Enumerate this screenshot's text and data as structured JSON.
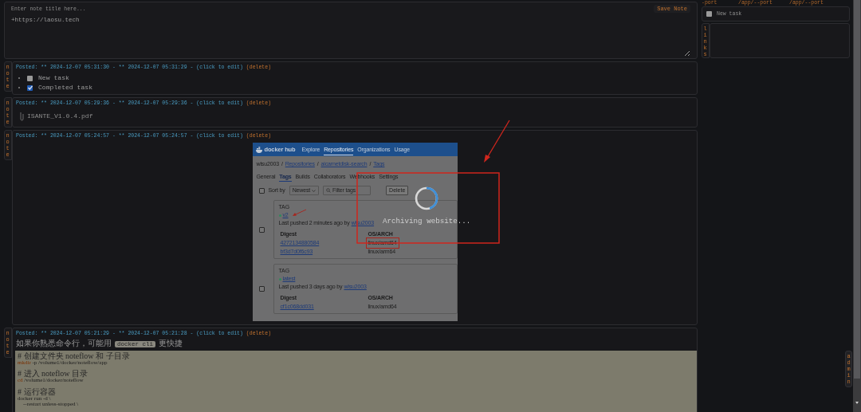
{
  "editor": {
    "title_placeholder": "Enter note title here...",
    "body_value": "+https://laosu.tech",
    "save_button": "Save Note"
  },
  "notes": [
    {
      "kind": "tasks",
      "side_label": "note",
      "posted": "Posted: ** 2024-12-07 05:31:30 - ** 2024-12-07 05:31:29 -",
      "edit_link": "(click to edit)",
      "delete_link": "(delete)",
      "tasks": [
        {
          "label": "New task",
          "checked": false
        },
        {
          "label": "Completed task",
          "checked": true
        }
      ]
    },
    {
      "kind": "file",
      "side_label": "note",
      "posted": "Posted: ** 2024-12-07 05:29:36 - ** 2024-12-07 05:29:36 -",
      "edit_link": "(click to edit)",
      "delete_link": "(delete)",
      "file_name": "ISANTE_V1.0.4.pdf"
    },
    {
      "kind": "image",
      "side_label": "note",
      "posted": "Posted: ** 2024-12-07 05:24:57 - ** 2024-12-07 05:24:57 -",
      "edit_link": "(click to edit)",
      "delete_link": "(delete)",
      "overlay_text": "Archiving website...",
      "screenshot": {
        "logo": "docker hub",
        "nav": [
          {
            "label": "Explore",
            "selected": false
          },
          {
            "label": "Repositories",
            "selected": true
          },
          {
            "label": "Organizations",
            "selected": false
          },
          {
            "label": "Usage",
            "selected": false
          }
        ],
        "breadcrumb": [
          "wlsu2003",
          "Repositories",
          "aicarnetdisk-search",
          "Tags"
        ],
        "breadcrumb_separator": "/",
        "tabs": [
          {
            "label": "General",
            "selected": false
          },
          {
            "label": "Tags",
            "selected": true
          },
          {
            "label": "Builds",
            "selected": false
          },
          {
            "label": "Collaborators",
            "selected": false
          },
          {
            "label": "Webhooks",
            "selected": false
          },
          {
            "label": "Settings",
            "selected": false
          }
        ],
        "select_all_checked": false,
        "sort_label": "Sort by",
        "sort_value": "Newest",
        "filter_placeholder": "Filter tags",
        "delete_button": "Delete",
        "tags": [
          {
            "checked": false,
            "heading": "TAG",
            "name": "v2",
            "color": "#2f8a5a",
            "pushed": "Last pushed 2 minutes ago by",
            "pushed_by": "wlsu2003",
            "columns": [
              "Digest",
              "OS/ARCH"
            ],
            "rows": [
              [
                "4272134880584",
                "linux/amd64"
              ],
              [
                "bf3d7d0f6c93",
                "linux/arm64"
              ]
            ]
          },
          {
            "checked": false,
            "heading": "TAG",
            "name": "latest",
            "color": "#2f8a5a",
            "pushed": "Last pushed 3 days ago by",
            "pushed_by": "wlsu2003",
            "columns": [
              "Digest",
              "OS/ARCH"
            ],
            "rows": [
              [
                "cf1c068dd031",
                "linux/amd64"
              ]
            ]
          }
        ]
      }
    },
    {
      "kind": "code",
      "side_label": "note",
      "posted": "Posted: ** 2024-12-07 05:21:29 - ** 2024-12-07 05:21:28 -",
      "edit_link": "(click to edit)",
      "delete_link": "(delete)",
      "intro": "如果你熟悉命令行，可能用",
      "intro_code": "docker cli",
      "intro_end": "更快捷",
      "code_lines": [
        {
          "kind": "comment",
          "text": "# 创建文件夹 noteflow 和 子目录"
        },
        {
          "kind": "command",
          "keyword": "mkdir",
          "text": " -p /volume1/docker/noteflow/app"
        },
        {
          "kind": "blank"
        },
        {
          "kind": "comment",
          "text": "# 进入 noteflow 目录"
        },
        {
          "kind": "command",
          "keyword": "cd",
          "text": " /volume1/docker/noteflow"
        },
        {
          "kind": "blank"
        },
        {
          "kind": "comment",
          "text": "# 运行容器"
        },
        {
          "kind": "plain",
          "text": "docker run -d \\"
        },
        {
          "kind": "plain",
          "text": "    --restart unless-stopped \\"
        }
      ]
    }
  ],
  "side": {
    "cut_texts": [
      "-port",
      "/app/--port",
      "/app/--port"
    ],
    "tasks": [
      {
        "label": "New task",
        "checked": false
      }
    ],
    "links_label": "links",
    "admin_label": "admin"
  }
}
